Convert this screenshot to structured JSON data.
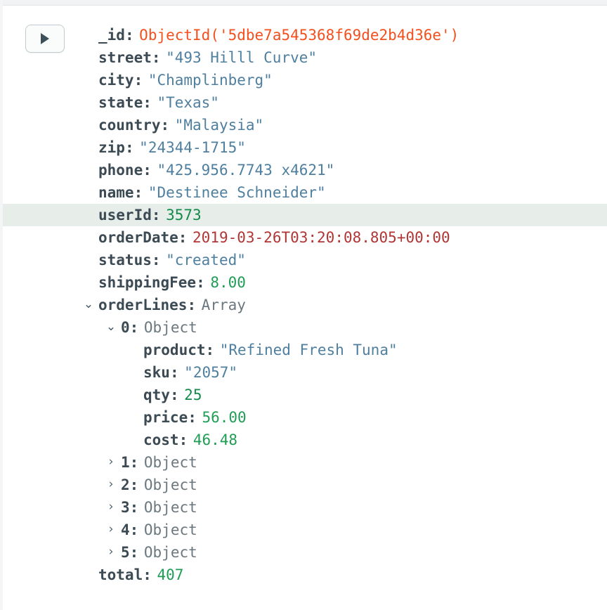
{
  "toolbar": {
    "expand_button_label": "▶",
    "expand_button_name": "expand-all"
  },
  "colors": {
    "key": "#3c4a54",
    "string": "#4f7f9f",
    "number": "#1f9d55",
    "objectid": "#f4501e",
    "date": "#b13535",
    "type": "#6b7880",
    "highlight_row_bg": "#e7eeea",
    "background": "#ffffff"
  },
  "icons": {
    "caret_expanded": "⌄",
    "caret_collapsed": "›",
    "play": "▶"
  },
  "document": {
    "fields": [
      {
        "key": "_id",
        "colon": ":",
        "value": "ObjectId('5dbe7a545368f69de2b4d36e')",
        "type": "objectid"
      },
      {
        "key": "street",
        "colon": ":",
        "value": "\"493 Hilll Curve\"",
        "type": "string"
      },
      {
        "key": "city",
        "colon": ":",
        "value": "\"Champlinberg\"",
        "type": "string"
      },
      {
        "key": "state",
        "colon": ":",
        "value": "\"Texas\"",
        "type": "string"
      },
      {
        "key": "country",
        "colon": ":",
        "value": "\"Malaysia\"",
        "type": "string"
      },
      {
        "key": "zip",
        "colon": ":",
        "value": "\"24344-1715\"",
        "type": "string"
      },
      {
        "key": "phone",
        "colon": ":",
        "value": "\"425.956.7743 x4621\"",
        "type": "string"
      },
      {
        "key": "name",
        "colon": ":",
        "value": "\"Destinee Schneider\"",
        "type": "string"
      },
      {
        "key": "userId",
        "colon": ":",
        "value": "3573",
        "type": "int"
      },
      {
        "key": "orderDate",
        "colon": ":",
        "value": "2019-03-26T03:20:08.805+00:00",
        "type": "date"
      },
      {
        "key": "status",
        "colon": ":",
        "value": "\"created\"",
        "type": "string"
      },
      {
        "key": "shippingFee",
        "colon": ":",
        "value": "8.00",
        "type": "number"
      },
      {
        "key": "orderLines",
        "colon": ":",
        "value": "Array",
        "type": "type"
      },
      {
        "key": "total",
        "colon": ":",
        "value": "407",
        "type": "number"
      }
    ],
    "order_lines": {
      "key": "orderLines",
      "type_label": "Array",
      "expanded_item": {
        "index": "0",
        "type_label": "Object",
        "fields": [
          {
            "key": "product",
            "colon": ":",
            "value": "\"Refined Fresh Tuna\"",
            "type": "string"
          },
          {
            "key": "sku",
            "colon": ":",
            "value": "\"2057\"",
            "type": "string"
          },
          {
            "key": "qty",
            "colon": ":",
            "value": "25",
            "type": "int"
          },
          {
            "key": "price",
            "colon": ":",
            "value": "56.00",
            "type": "number"
          },
          {
            "key": "cost",
            "colon": ":",
            "value": "46.48",
            "type": "number"
          }
        ]
      },
      "collapsed_items": [
        {
          "index": "1",
          "colon": ":",
          "type_label": "Object"
        },
        {
          "index": "2",
          "colon": ":",
          "type_label": "Object"
        },
        {
          "index": "3",
          "colon": ":",
          "type_label": "Object"
        },
        {
          "index": "4",
          "colon": ":",
          "type_label": "Object"
        },
        {
          "index": "5",
          "colon": ":",
          "type_label": "Object"
        }
      ]
    },
    "total_field": {
      "key": "total",
      "colon": ":",
      "value": "407",
      "type": "number"
    }
  }
}
